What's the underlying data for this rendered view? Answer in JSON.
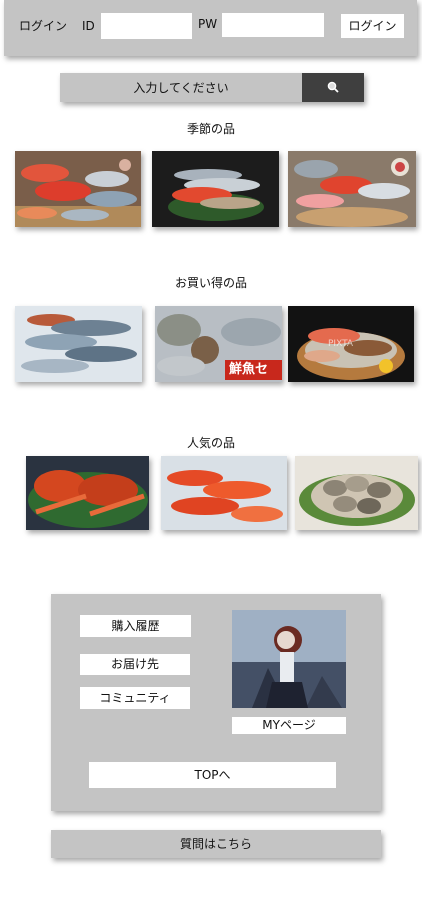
{
  "login": {
    "title": "ログイン",
    "id_label": "ID",
    "pw_label": "PW",
    "button_label": "ログイン"
  },
  "search": {
    "placeholder": "入力してください",
    "icon": "search-icon"
  },
  "sections": {
    "seasonal": {
      "title": "季節の品"
    },
    "bargain": {
      "title": "お買い得の品",
      "overlay_text": "鮮魚セ",
      "watermark": "PIXTA"
    },
    "popular": {
      "title": "人気の品"
    }
  },
  "account": {
    "purchase_history": "購入履歴",
    "delivery": "お届け先",
    "community": "コミュニティ",
    "mypage": "MYページ",
    "top": "TOPへ"
  },
  "faq": {
    "label": "質問はこちら"
  },
  "colors": {
    "panel_gray": "#c4c4c4",
    "search_button": "#3f3f3f",
    "white": "#ffffff"
  }
}
